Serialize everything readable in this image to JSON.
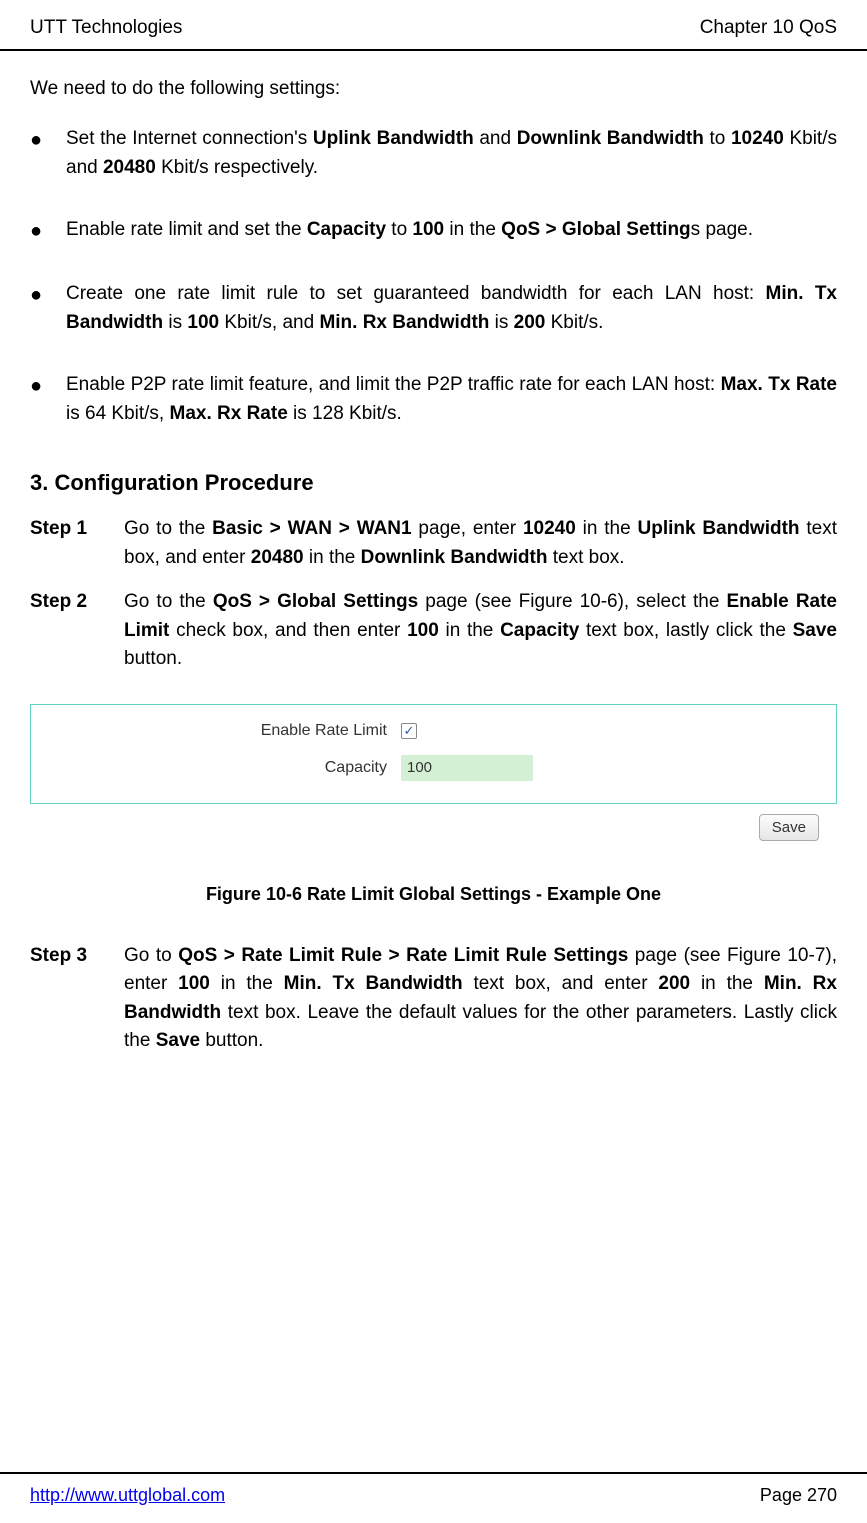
{
  "header": {
    "left": "UTT Technologies",
    "right": "Chapter 10 QoS"
  },
  "intro": "We need to do the following settings:",
  "bullets": [
    {
      "parts": [
        {
          "t": "Set the Internet connection's ",
          "b": false
        },
        {
          "t": "Uplink Bandwidth",
          "b": true
        },
        {
          "t": " and ",
          "b": false
        },
        {
          "t": "Downlink Bandwidth",
          "b": true
        },
        {
          "t": " to ",
          "b": false
        },
        {
          "t": "10240",
          "b": true
        },
        {
          "t": " Kbit/s and ",
          "b": false
        },
        {
          "t": "20480",
          "b": true
        },
        {
          "t": " Kbit/s respectively.",
          "b": false
        }
      ]
    },
    {
      "parts": [
        {
          "t": "Enable rate limit and set the ",
          "b": false
        },
        {
          "t": "Capacity",
          "b": true
        },
        {
          "t": " to ",
          "b": false
        },
        {
          "t": "100",
          "b": true
        },
        {
          "t": " in the ",
          "b": false
        },
        {
          "t": "QoS > Global Setting",
          "b": true
        },
        {
          "t": "s page.",
          "b": false
        }
      ]
    },
    {
      "parts": [
        {
          "t": "Create one rate limit rule to set guaranteed bandwidth for each LAN host: ",
          "b": false
        },
        {
          "t": "Min. Tx Bandwidth",
          "b": true
        },
        {
          "t": " is ",
          "b": false
        },
        {
          "t": "100",
          "b": true
        },
        {
          "t": " Kbit/s, and ",
          "b": false
        },
        {
          "t": "Min. Rx Bandwidth",
          "b": true
        },
        {
          "t": " is ",
          "b": false
        },
        {
          "t": "200",
          "b": true
        },
        {
          "t": " Kbit/s.",
          "b": false
        }
      ]
    },
    {
      "parts": [
        {
          "t": "Enable P2P rate limit feature, and limit the P2P traffic rate for each LAN host: ",
          "b": false
        },
        {
          "t": "Max. Tx Rate",
          "b": true
        },
        {
          "t": " is 64 Kbit/s, ",
          "b": false
        },
        {
          "t": "Max. Rx Rate",
          "b": true
        },
        {
          "t": " is 128 Kbit/s.",
          "b": false
        }
      ]
    }
  ],
  "sectionTitle": "3.   Configuration Procedure",
  "steps": [
    {
      "label": "Step 1",
      "parts": [
        {
          "t": "Go to the ",
          "b": false
        },
        {
          "t": "Basic > WAN > WAN1",
          "b": true
        },
        {
          "t": " page, enter ",
          "b": false
        },
        {
          "t": "10240",
          "b": true
        },
        {
          "t": " in the ",
          "b": false
        },
        {
          "t": "Uplink Bandwidth",
          "b": true
        },
        {
          "t": " text box, and enter ",
          "b": false
        },
        {
          "t": "20480",
          "b": true
        },
        {
          "t": " in the ",
          "b": false
        },
        {
          "t": "Downlink Bandwidth",
          "b": true
        },
        {
          "t": " text box.",
          "b": false
        }
      ]
    },
    {
      "label": "Step 2",
      "parts": [
        {
          "t": "Go to the ",
          "b": false
        },
        {
          "t": "QoS > Global Settings",
          "b": true
        },
        {
          "t": " page (see Figure 10-6), select the ",
          "b": false
        },
        {
          "t": "Enable Rate Limit",
          "b": true
        },
        {
          "t": " check box, and then enter ",
          "b": false
        },
        {
          "t": "100",
          "b": true
        },
        {
          "t": " in the ",
          "b": false
        },
        {
          "t": "Capacity",
          "b": true
        },
        {
          "t": " text box, lastly click the ",
          "b": false
        },
        {
          "t": "Save",
          "b": true
        },
        {
          "t": " button.",
          "b": false
        }
      ]
    }
  ],
  "form": {
    "enableRateLimitLabel": "Enable Rate Limit",
    "capacityLabel": "Capacity",
    "capacityValue": "100",
    "checkboxChecked": "✓",
    "saveLabel": "Save"
  },
  "figureCaption": "Figure 10-6 Rate Limit Global Settings - Example One",
  "step3": {
    "label": "Step 3",
    "parts": [
      {
        "t": "Go to ",
        "b": false
      },
      {
        "t": "QoS > Rate Limit Rule > Rate Limit Rule Settings",
        "b": true
      },
      {
        "t": " page (see Figure 10-7), enter ",
        "b": false
      },
      {
        "t": "100",
        "b": true
      },
      {
        "t": " in the ",
        "b": false
      },
      {
        "t": "Min. Tx Bandwidth",
        "b": true
      },
      {
        "t": " text box, and enter ",
        "b": false
      },
      {
        "t": "200",
        "b": true
      },
      {
        "t": " in the ",
        "b": false
      },
      {
        "t": "Min. Rx Bandwidth",
        "b": true
      },
      {
        "t": " text box. Leave the default values for the other parameters. Lastly click the ",
        "b": false
      },
      {
        "t": "Save",
        "b": true
      },
      {
        "t": " button.",
        "b": false
      }
    ]
  },
  "footer": {
    "url": "http://www.uttglobal.com",
    "page": "Page 270"
  }
}
